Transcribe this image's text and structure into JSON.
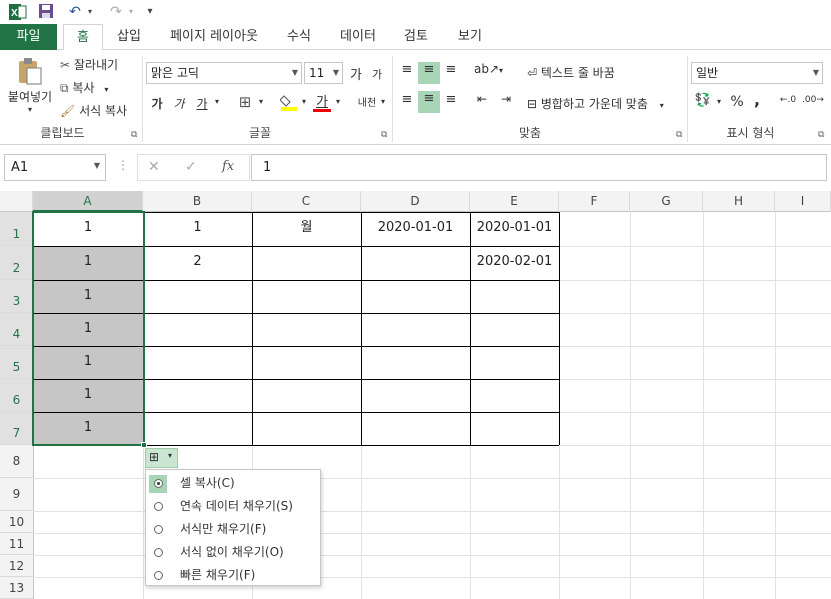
{
  "qat": {
    "excel_icon": "excel-logo-icon",
    "save_icon": "save-icon",
    "undo_icon": "undo-icon",
    "redo_icon": "redo-icon",
    "customize_icon": "customize-qat-icon"
  },
  "tabs": [
    "파일",
    "홈",
    "삽입",
    "페이지 레이아웃",
    "수식",
    "데이터",
    "검토",
    "보기"
  ],
  "ribbon": {
    "clipboard": {
      "paste": "붙여넣기",
      "cut": "잘라내기",
      "copy": "복사",
      "format_painter": "서식 복사",
      "label": "클립보드"
    },
    "font": {
      "name": "맑은 고딕",
      "size": "11",
      "grow": "가",
      "shrink": "가",
      "bold": "가",
      "italic": "가",
      "underline": "가",
      "font_color_glyph": "가",
      "phonetic": "내천",
      "label": "글꼴"
    },
    "alignment": {
      "wrap_text": "텍스트 줄 바꿈",
      "merge_center": "병합하고 가운데 맞춤",
      "label": "맞춤"
    },
    "number": {
      "format": "일반",
      "percent": "%",
      "comma": ",",
      "label": "표시 형식"
    }
  },
  "formula_bar": {
    "name_box": "A1",
    "fx": "fx",
    "value": "1"
  },
  "columns": [
    "A",
    "B",
    "C",
    "D",
    "E",
    "F",
    "G",
    "H",
    "I"
  ],
  "rows": [
    "1",
    "2",
    "3",
    "4",
    "5",
    "6",
    "7",
    "8",
    "9",
    "10",
    "11",
    "12",
    "13"
  ],
  "cells": {
    "A1": "1",
    "A2": "1",
    "A3": "1",
    "A4": "1",
    "A5": "1",
    "A6": "1",
    "A7": "1",
    "B1": "1",
    "B2": "2",
    "C1": "월",
    "D1": "2020-01-01",
    "E1": "2020-01-01",
    "E2": "2020-02-01"
  },
  "autofill_menu": {
    "items": [
      {
        "label": "셀 복사(C)",
        "selected": true
      },
      {
        "label": "연속 데이터 채우기(S)",
        "selected": false
      },
      {
        "label": "서식만 채우기(F)",
        "selected": false
      },
      {
        "label": "서식 없이 채우기(O)",
        "selected": false
      },
      {
        "label": "빠른 채우기(F)",
        "selected": false
      }
    ]
  },
  "colors": {
    "accent": "#217346",
    "selection": "#c6c6c6",
    "highlight": "#a8d5b5"
  }
}
